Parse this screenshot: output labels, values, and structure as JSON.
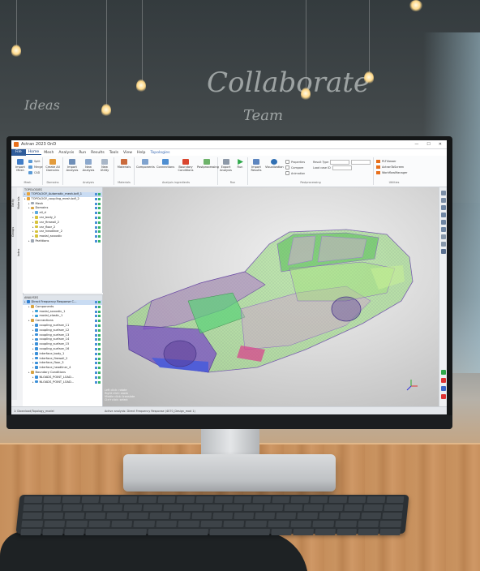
{
  "app": {
    "title": "Actran 2023 OnD",
    "window_controls": [
      "—",
      "☐",
      "✕"
    ]
  },
  "menu": {
    "file": "File",
    "items": [
      "Home",
      "Mesh",
      "Analysis",
      "Run",
      "Results",
      "Tools",
      "View",
      "Help"
    ],
    "active": "Home",
    "extra": "Topologies"
  },
  "ribbon": {
    "mesh_group": {
      "label": "Mesh",
      "buttons": [
        "Import Mesh"
      ],
      "small": [
        "Split",
        "Merge",
        "CAD"
      ]
    },
    "domains_group": {
      "label": "Domains",
      "buttons": [
        "Create All Domains"
      ]
    },
    "analysis_group": {
      "label": "Analysis",
      "buttons": [
        "Import Analysis",
        "New Analysis",
        "New Utility"
      ]
    },
    "materials_group": {
      "label": "Materials",
      "buttons": [
        "Materials"
      ]
    },
    "ingredients_group": {
      "label": "Analysis ingredients",
      "buttons": [
        "Components",
        "Connections",
        "Boundary Conditions",
        "Postprocessing"
      ]
    },
    "run_group": {
      "label": "Run",
      "buttons": [
        "Export Analysis",
        "Run"
      ]
    },
    "post_group": {
      "label": "Postprocessing",
      "buttons": [
        "Import Results",
        "Visualization"
      ],
      "checks": [
        "Properties",
        "Compare",
        "Animation"
      ],
      "fields": [
        "Result Type",
        "Load case ID"
      ]
    },
    "utilities_group": {
      "label": "Utilities",
      "items": [
        "PLTViewer",
        "ActranToScreen",
        "WorkflowManager"
      ]
    }
  },
  "left_tabs": [
    "Entity",
    "Groups",
    "Materials",
    "Index"
  ],
  "topology_tree": {
    "header": "TOPOLOGIES",
    "rows": [
      {
        "label": "TOPOLOGY_Automatic_mesh.bdf_1",
        "indent": 0,
        "selected": true,
        "color": "#e8a33a"
      },
      {
        "label": "TOPOLOGY_coupling_mesh.bdf_2",
        "indent": 0,
        "selected": false,
        "color": "#e8a33a"
      },
      {
        "label": "Mesh",
        "indent": 1,
        "selected": false,
        "color": "#9ea7b3"
      },
      {
        "label": "Domains",
        "indent": 1,
        "selected": false,
        "color": "#d9a441"
      },
      {
        "label": "all_d",
        "indent": 2,
        "selected": false,
        "color": "#5aa8e0"
      },
      {
        "label": "car_body_2",
        "indent": 2,
        "selected": false,
        "color": "#d6c23a"
      },
      {
        "label": "car_firewall_2",
        "indent": 2,
        "selected": false,
        "color": "#d6c23a"
      },
      {
        "label": "car_floor_2",
        "indent": 2,
        "selected": false,
        "color": "#d6c23a"
      },
      {
        "label": "car_headliner_2",
        "indent": 2,
        "selected": false,
        "color": "#d6c23a"
      },
      {
        "label": "modal_acoustic",
        "indent": 2,
        "selected": false,
        "color": "#d6c23a"
      },
      {
        "label": "Partitions",
        "indent": 1,
        "selected": false,
        "color": "#9ea7b3"
      }
    ]
  },
  "analysis_tree": {
    "header": "ANALYSES",
    "rows": [
      {
        "label": "Direct Frequency Response C...",
        "indent": 0,
        "selected": true,
        "color": "#2f7fd1"
      },
      {
        "label": "Components",
        "indent": 1,
        "selected": false,
        "color": "#d9a441"
      },
      {
        "label": "modal_acoustic_1",
        "indent": 2,
        "selected": false,
        "color": "#3aa0d8"
      },
      {
        "label": "modal_elastic_1",
        "indent": 2,
        "selected": false,
        "color": "#3aa0d8"
      },
      {
        "label": "Connections",
        "indent": 1,
        "selected": false,
        "color": "#d9a441"
      },
      {
        "label": "coupling_surface_11",
        "indent": 2,
        "selected": false,
        "color": "#3a8fd8"
      },
      {
        "label": "coupling_surface_12",
        "indent": 2,
        "selected": false,
        "color": "#3a8fd8"
      },
      {
        "label": "coupling_surface_13",
        "indent": 2,
        "selected": false,
        "color": "#3a8fd8"
      },
      {
        "label": "coupling_surface_14",
        "indent": 2,
        "selected": false,
        "color": "#3a8fd8"
      },
      {
        "label": "coupling_surface_15",
        "indent": 2,
        "selected": false,
        "color": "#3a8fd8"
      },
      {
        "label": "coupling_surface_16",
        "indent": 2,
        "selected": false,
        "color": "#3a8fd8"
      },
      {
        "label": "interface_body_1",
        "indent": 2,
        "selected": false,
        "color": "#3a8fd8"
      },
      {
        "label": "interface_firewall_2",
        "indent": 2,
        "selected": false,
        "color": "#3a8fd8"
      },
      {
        "label": "interface_floor_3",
        "indent": 2,
        "selected": false,
        "color": "#3a8fd8"
      },
      {
        "label": "interface_headliner_4",
        "indent": 2,
        "selected": false,
        "color": "#3a8fd8"
      },
      {
        "label": "Boundary Conditions",
        "indent": 1,
        "selected": false,
        "color": "#d9a441"
      },
      {
        "label": "NLOADS_POINT_LOAD...",
        "indent": 2,
        "selected": false,
        "color": "#3a8fd8"
      },
      {
        "label": "NLOADS_POINT_LOAD...",
        "indent": 2,
        "selected": false,
        "color": "#3a8fd8"
      }
    ]
  },
  "viewport": {
    "info_lines": [
      "Left click: rotate",
      "Right click: zoom",
      "Middle click: translate",
      "Ctrl+click: select"
    ]
  },
  "statusbar": {
    "left": "1: Download/Topology_model",
    "right": "Active analysis: Direct Frequency Response (4070_Design_mod 1)"
  },
  "colors": {
    "accent": "#2f5c9a",
    "orange": "#e8701c"
  },
  "icons": [
    "import-mesh-icon",
    "create-domains-icon",
    "import-analysis-icon",
    "new-analysis-icon",
    "materials-icon",
    "components-icon",
    "connections-icon",
    "boundary-conditions-icon",
    "postprocessing-icon",
    "export-icon",
    "run-icon",
    "import-results-icon",
    "visualization-icon",
    "axis-triad-icon"
  ]
}
